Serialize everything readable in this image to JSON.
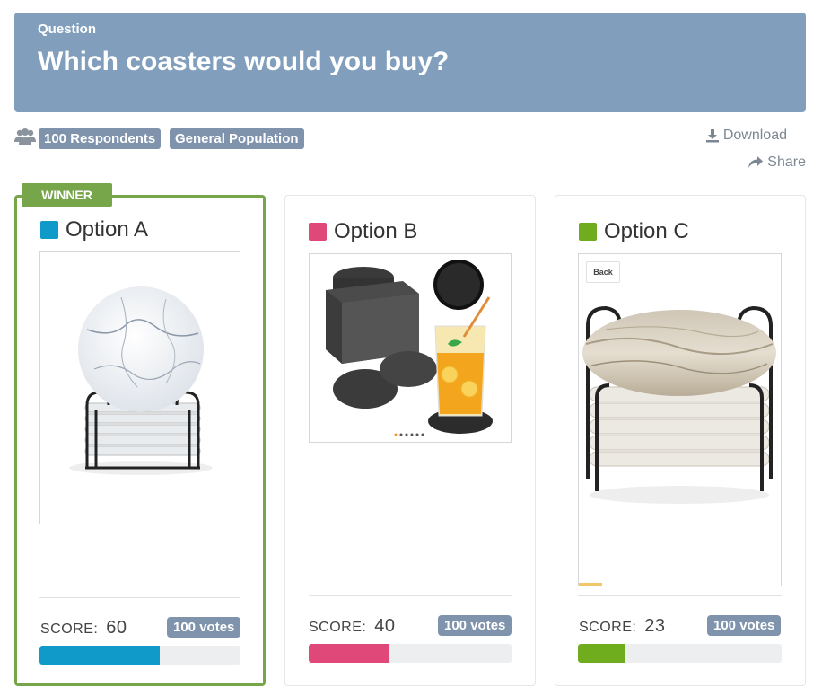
{
  "question": {
    "label": "Question",
    "title": "Which coasters would you buy?"
  },
  "meta": {
    "respondents_icon": "users-icon",
    "respondents": "100 Respondents",
    "population": "General Population",
    "download_label": "Download",
    "download_icon": "download-icon",
    "share_label": "Share",
    "share_icon": "share-icon"
  },
  "winner_label": "WINNER",
  "score_label": "SCORE:",
  "options": [
    {
      "name": "Option A",
      "color": "#0f9ac9",
      "score": "60",
      "score_fraction": 0.6,
      "votes": "100 votes",
      "image": "marble-coasters-with-holder",
      "winner": true
    },
    {
      "name": "Option B",
      "color": "#e0487a",
      "score": "40",
      "score_fraction": 0.4,
      "votes": "100 votes",
      "image": "felt-coasters-with-box-and-glass",
      "winner": false
    },
    {
      "name": "Option C",
      "color": "#6fad1f",
      "score": "23",
      "score_fraction": 0.23,
      "votes": "100 votes",
      "image": "stone-coasters-with-holder",
      "winner": false,
      "image_back_label": "Back"
    }
  ]
}
